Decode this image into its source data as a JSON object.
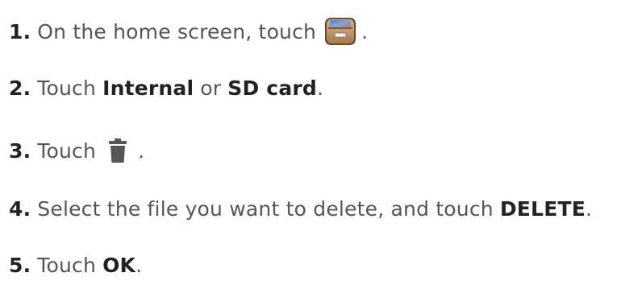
{
  "steps": [
    {
      "number": "1.",
      "text_before": "On the home screen, touch",
      "icon": "file-manager-icon",
      "text_after": "."
    },
    {
      "number": "2.",
      "text_before": "Touch",
      "bold_1": "Internal",
      "text_middle": "or",
      "bold_2": "SD card",
      "text_after": "."
    },
    {
      "number": "3.",
      "text_before": "Touch",
      "icon": "trash-icon",
      "text_after": "."
    },
    {
      "number": "4.",
      "text_before": "Select the file you want to delete, and touch",
      "bold_1": "DELETE",
      "text_after": "."
    },
    {
      "number": "5.",
      "text_before": "Touch",
      "bold_1": "OK",
      "text_after": "."
    }
  ]
}
